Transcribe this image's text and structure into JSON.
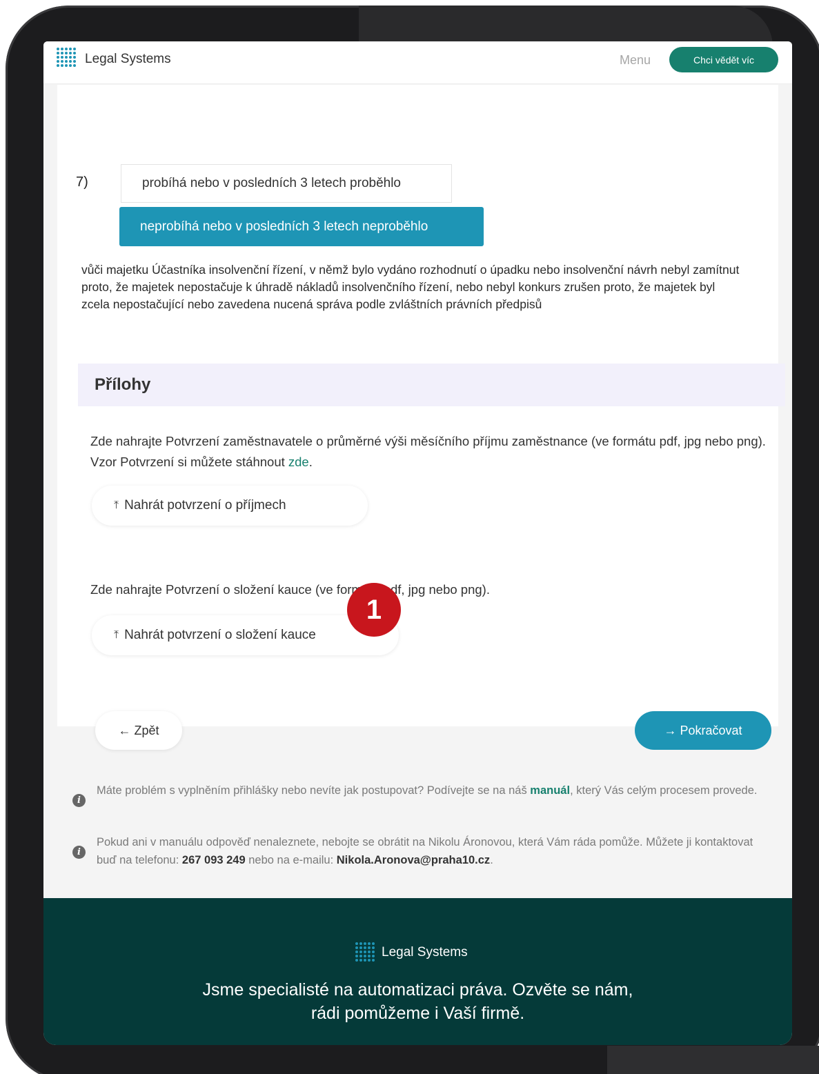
{
  "header": {
    "brand": "Legal Systems",
    "menu_label": "Menu",
    "cta_label": "Chci vědět víc"
  },
  "question": {
    "number": "7)",
    "option_a": "probíhá nebo v posledních 3 letech proběhlo",
    "option_b": "neprobíhá nebo v posledních 3 letech neproběhlo",
    "selected": "option_b",
    "description": "vůči majetku Účastníka insolvenční řízení, v němž bylo vydáno rozhodnutí o úpadku nebo insolvenční návrh nebyl zamítnut proto, že majetek nepostačuje k úhradě nákladů insolvenčního řízení, nebo nebyl konkurs zrušen proto, že majetek byl zcela nepostačující nebo zavedena nucená správa podle zvláštních právních předpisů"
  },
  "attachments": {
    "title": "Přílohy",
    "income_text": "Zde nahrajte Potvrzení zaměstnavatele o průměrné výši měsíčního příjmu zaměstnance (ve formátu pdf, jpg nebo png). Vzor Potvrzení si můžete stáhnout ",
    "income_link": "zde",
    "income_text_end": ".",
    "income_button": "Nahrát potvrzení o příjmech",
    "deposit_text": "Zde nahrajte Potvrzení o složení kauce (ve formátu pdf, jpg nebo png).",
    "deposit_button": "Nahrát potvrzení o složení kauce",
    "upload_icon": "upload-icon"
  },
  "annotation_badge": "1",
  "navigation": {
    "back_label": "← Zpět",
    "next_label": "→ Pokračovat"
  },
  "help": {
    "note1_pre": "Máte problém s vyplněním přihlášky nebo nevíte jak postupovat? Podívejte se na náš ",
    "note1_link": "manuál",
    "note1_post": ", který Vás celým procesem provede.",
    "note2_pre": "Pokud ani v manuálu odpověď nenaleznete, nebojte se obrátit na Nikolu Áronovou, která Vám ráda pomůže. Můžete ji kontaktovat buď na telefonu: ",
    "phone": "267 093 249",
    "note2_mid": " nebo na e-mailu: ",
    "email": "Nikola.Aronova@praha10.cz",
    "note2_end": "."
  },
  "footer": {
    "brand": "Legal Systems",
    "tagline_line1": "Jsme specialisté na automatizaci práva. Ozvěte se nám,",
    "tagline_line2": "rádi pomůžeme i Vaší firmě."
  },
  "colors": {
    "accent_teal": "#1e95b5",
    "brand_green": "#17806e",
    "footer_bg": "#053a39",
    "badge_red": "#c8161d"
  }
}
